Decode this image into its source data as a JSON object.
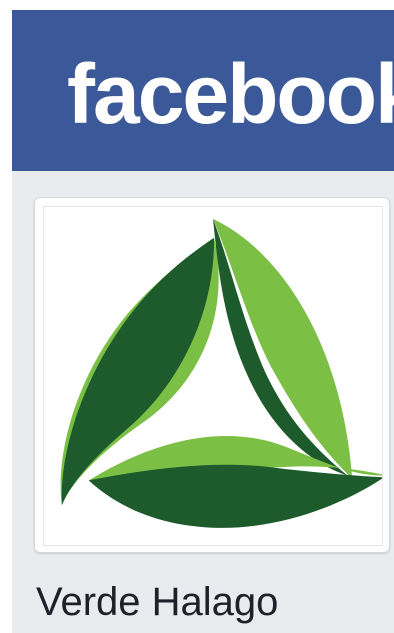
{
  "header": {
    "wordmark": "facebook"
  },
  "profile": {
    "logo_icon": "three-leaf-triangle-logo",
    "page_name": "Verde Halago"
  },
  "colors": {
    "facebook_blue": "#3b5998",
    "page_background": "#e9ebee",
    "leaf_dark_green": "#1d5a2c",
    "leaf_light_green": "#7cbf45"
  }
}
